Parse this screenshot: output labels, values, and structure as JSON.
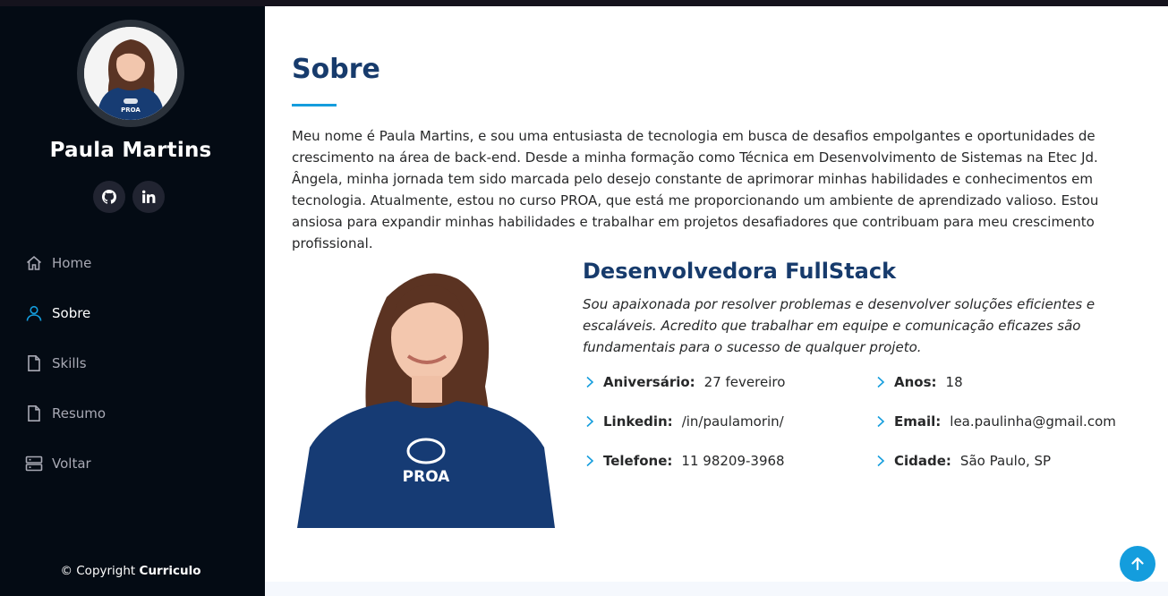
{
  "sidebar": {
    "profile_name": "Paula Martins",
    "social": [
      {
        "icon": "github-icon"
      },
      {
        "icon": "linkedin-icon"
      }
    ],
    "nav": [
      {
        "label": "Home",
        "icon": "home-icon",
        "active": false
      },
      {
        "label": "Sobre",
        "icon": "user-icon",
        "active": true
      },
      {
        "label": "Skills",
        "icon": "file-icon",
        "active": false
      },
      {
        "label": "Resumo",
        "icon": "file-icon",
        "active": false
      },
      {
        "label": "Voltar",
        "icon": "server-icon",
        "active": false
      }
    ],
    "copyright_prefix": "© Copyright",
    "copyright_brand": "Curriculo"
  },
  "about": {
    "title": "Sobre",
    "intro": "Meu nome é Paula Martins, e sou uma entusiasta de tecnologia em busca de desafios empolgantes e oportunidades de crescimento na área de back-end. Desde a minha formação como Técnica em Desenvolvimento de Sistemas na Etec Jd. Ângela, minha jornada tem sido marcada pelo desejo constante de aprimorar minhas habilidades e conhecimentos em tecnologia. Atualmente, estou no curso PROA, que está me proporcionando um ambiente de aprendizado valioso. Estou ansiosa para expandir minhas habilidades e trabalhar em projetos desafiadores que contribuam para meu crescimento profissional.",
    "role_title": "Desenvolvedora FullStack",
    "role_desc": "Sou apaixonada por resolver problemas e desenvolver soluções eficientes e escaláveis. Acredito que trabalhar em equipe e comunicação eficazes são fundamentais para o sucesso de qualquer projeto.",
    "shirt_text": "PROA",
    "info": {
      "aniversario": {
        "label": "Aniversário:",
        "value": "27 fevereiro"
      },
      "anos": {
        "label": "Anos:",
        "value": "18"
      },
      "linkedin": {
        "label": "Linkedin:",
        "value": "/in/paulamorin/"
      },
      "email": {
        "label": "Email:",
        "value": "lea.paulinha@gmail.com"
      },
      "telefone": {
        "label": "Telefone:",
        "value": "11 98209-3968"
      },
      "cidade": {
        "label": "Cidade:",
        "value": "São Paulo, SP"
      }
    }
  },
  "colors": {
    "sidebar_bg": "#040b14",
    "accent": "#149ddd",
    "heading": "#173b6c",
    "text": "#272829"
  }
}
